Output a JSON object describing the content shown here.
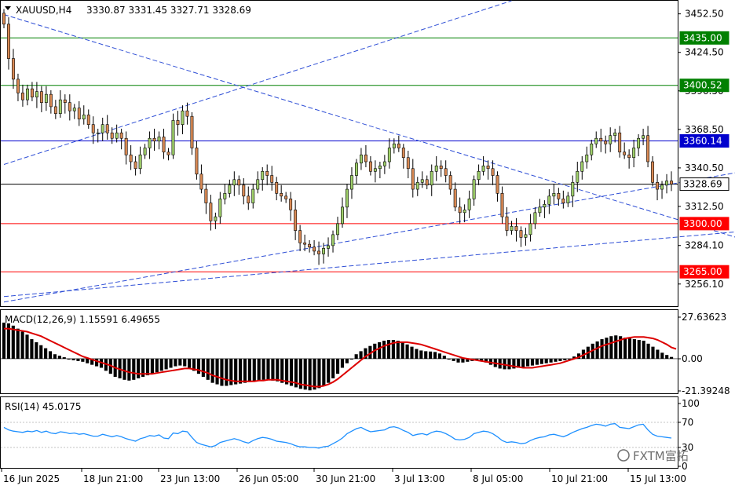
{
  "header": {
    "symbol": "XAUUSD,H4",
    "ohlc": "3330.87 3331.45 3327.71 3328.69"
  },
  "watermark": "FXTM富拓",
  "colors": {
    "bull": "#9fcf6a",
    "bear": "#d98a55",
    "wick": "#000000",
    "green_level": "#008000",
    "blue_level": "#0000cd",
    "red_level": "#ff0000",
    "current_level": "#000000",
    "trend_line": "#2f4fd6",
    "macd_hist": "#000000",
    "macd_signal": "#dd0000",
    "rsi_line": "#1e90ff"
  },
  "chart_data": [
    {
      "type": "candlestick",
      "title": "XAUUSD,H4",
      "ylim": [
        3240,
        3462
      ],
      "y_ticks": [
        "3452.50",
        "3424.50",
        "3396.50",
        "3368.50",
        "3340.50",
        "3312.50",
        "3284.10",
        "3256.10"
      ],
      "x_ticks": [
        "16 Jun 2025",
        "18 Jun 21:00",
        "23 Jun 13:00",
        "26 Jun 05:00",
        "30 Jun 21:00",
        "3 Jul 13:00",
        "8 Jul 05:00",
        "10 Jul 21:00",
        "15 Jul 13:00"
      ],
      "levels": [
        {
          "name": "resistance",
          "value": 3435.0,
          "label": "3435.00",
          "color": "#008000"
        },
        {
          "name": "resistance",
          "value": 3400.52,
          "label": "3400.52",
          "color": "#008000"
        },
        {
          "name": "pivot",
          "value": 3360.14,
          "label": "3360.14",
          "color": "#0000cd"
        },
        {
          "name": "current",
          "value": 3328.69,
          "label": "3328.69",
          "color": "#000000"
        },
        {
          "name": "support",
          "value": 3300.0,
          "label": "3300.00",
          "color": "#ff0000"
        },
        {
          "name": "support",
          "value": 3265.0,
          "label": "3265.00",
          "color": "#ff0000"
        }
      ],
      "trend_lines": [
        {
          "from": [
            0,
            3343
          ],
          "to": [
            108,
            3462
          ]
        },
        {
          "from": [
            0,
            3452
          ],
          "to": [
            200,
            3244
          ]
        },
        {
          "from": [
            0,
            3243
          ],
          "to": [
            212,
            3371
          ]
        },
        {
          "from": [
            0,
            3247
          ],
          "to": [
            212,
            3311
          ]
        }
      ],
      "closes": [
        3445,
        3420,
        3405,
        3395,
        3390,
        3398,
        3392,
        3396,
        3388,
        3394,
        3385,
        3380,
        3390,
        3388,
        3382,
        3384,
        3376,
        3379,
        3372,
        3366,
        3366,
        3372,
        3366,
        3362,
        3366,
        3362,
        3350,
        3345,
        3340,
        3350,
        3355,
        3362,
        3360,
        3363,
        3352,
        3350,
        3375,
        3372,
        3382,
        3378,
        3355,
        3336,
        3325,
        3315,
        3302,
        3305,
        3318,
        3322,
        3328,
        3332,
        3328,
        3320,
        3315,
        3325,
        3332,
        3338,
        3335,
        3330,
        3322,
        3320,
        3318,
        3310,
        3295,
        3286,
        3285,
        3283,
        3280,
        3278,
        3282,
        3284,
        3292,
        3300,
        3312,
        3325,
        3335,
        3344,
        3350,
        3345,
        3338,
        3340,
        3342,
        3345,
        3355,
        3358,
        3355,
        3348,
        3340,
        3325,
        3330,
        3332,
        3328,
        3338,
        3342,
        3340,
        3335,
        3325,
        3312,
        3308,
        3310,
        3318,
        3332,
        3338,
        3342,
        3340,
        3335,
        3322,
        3305,
        3295,
        3298,
        3295,
        3290,
        3292,
        3300,
        3308,
        3312,
        3314,
        3320,
        3322,
        3318,
        3315,
        3320,
        3330,
        3338,
        3345,
        3350,
        3358,
        3362,
        3360,
        3358,
        3364,
        3366,
        3352,
        3350,
        3348,
        3355,
        3362,
        3364,
        3345,
        3330,
        3325,
        3328,
        3331,
        3328.69
      ]
    },
    {
      "type": "bar",
      "title": "MACD(12,26,9) 1.15591 6.49655",
      "ylim": [
        -21.39248,
        27.63623
      ],
      "y_ticks": [
        "27.63623",
        "0.00",
        "-21.39248"
      ],
      "series": [
        {
          "name": "main",
          "values": [
            24,
            23.5,
            22,
            20,
            18,
            16,
            13,
            11,
            9,
            7,
            5,
            3,
            2,
            1,
            -0.5,
            -1,
            -1.5,
            -2,
            -3,
            -4,
            -5,
            -6,
            -8,
            -10,
            -12,
            -13,
            -14,
            -14.5,
            -14,
            -13,
            -12,
            -11,
            -10,
            -9,
            -8,
            -7,
            -6,
            -5,
            -4.5,
            -5,
            -6,
            -8,
            -10,
            -12,
            -14,
            -16,
            -17,
            -18,
            -18,
            -17.5,
            -17,
            -16.5,
            -16,
            -15.5,
            -15,
            -14.5,
            -14,
            -14,
            -14.5,
            -15,
            -16,
            -17,
            -18,
            -19,
            -20,
            -20.5,
            -21,
            -20.5,
            -19.5,
            -18,
            -16,
            -13,
            -10,
            -6,
            -3,
            0,
            3,
            5,
            7,
            8.5,
            10,
            11,
            12,
            12.5,
            12.5,
            12,
            11,
            9.5,
            8,
            6.5,
            5.5,
            5,
            4.8,
            4.5,
            3.5,
            2,
            0,
            -1.5,
            -2.5,
            -2.5,
            -2,
            -1.5,
            -1,
            -1.5,
            -2.5,
            -4,
            -5.5,
            -6.5,
            -7,
            -7,
            -6.5,
            -6,
            -5.5,
            -5,
            -4.5,
            -4,
            -3.5,
            -3,
            -2.5,
            -2,
            -1.5,
            -1,
            0,
            1.5,
            3.5,
            6,
            8,
            10,
            11.5,
            13,
            14,
            15,
            15.5,
            15,
            14,
            13.5,
            13,
            12.5,
            12,
            10,
            8,
            6,
            4,
            2.5,
            1.2
          ],
          "plotted_as": "histogram"
        },
        {
          "name": "signal",
          "values": [
            20,
            20,
            19.5,
            19,
            18.5,
            18,
            17,
            16,
            15,
            13.5,
            12,
            10.5,
            9,
            7.5,
            6,
            4.5,
            3,
            1.5,
            0.5,
            -0.5,
            -1.5,
            -2.5,
            -3.5,
            -4.5,
            -6,
            -7,
            -8,
            -9,
            -9.5,
            -10,
            -10,
            -10,
            -10,
            -9.5,
            -9,
            -8.5,
            -8,
            -7.5,
            -7,
            -6.5,
            -6.5,
            -7,
            -7.5,
            -8.5,
            -9.5,
            -11,
            -12,
            -13,
            -14,
            -14.5,
            -15,
            -15,
            -15,
            -15,
            -15,
            -14.5,
            -14.5,
            -14,
            -14,
            -14,
            -14.5,
            -15,
            -15.5,
            -16,
            -17,
            -17.5,
            -18,
            -18.5,
            -18.5,
            -18,
            -17,
            -15.5,
            -13.5,
            -11,
            -8.5,
            -6,
            -3.5,
            -1,
            1.5,
            3.5,
            5.5,
            7,
            8.5,
            9.5,
            10.5,
            11,
            11,
            11,
            10.5,
            10,
            9.5,
            8.5,
            7.5,
            6.5,
            5.5,
            4.5,
            3.5,
            2.5,
            1.5,
            0.5,
            0,
            -0.5,
            -1,
            -1.5,
            -2,
            -2.5,
            -3,
            -3.5,
            -4,
            -4.5,
            -5,
            -5.5,
            -6,
            -6,
            -6,
            -5.5,
            -5,
            -4.5,
            -4,
            -3.5,
            -3,
            -2,
            -1,
            0,
            1,
            2.5,
            4,
            5.5,
            7,
            8.5,
            9.5,
            10.5,
            11.5,
            12.5,
            13.5,
            14,
            14.5,
            14.5,
            14.5,
            14,
            13.5,
            12.5,
            11,
            9.5,
            7.5,
            6.5
          ],
          "plotted_as": "line"
        }
      ]
    },
    {
      "type": "line",
      "title": "RSI(14) 45.0175",
      "ylim": [
        0,
        100
      ],
      "y_ticks": [
        "100",
        "70",
        "30",
        "0"
      ],
      "levels": [
        70,
        30
      ],
      "series": [
        {
          "name": "RSI",
          "values": [
            62,
            58,
            56,
            55,
            54,
            56,
            55,
            57,
            54,
            56,
            53,
            52,
            55,
            54,
            52,
            53,
            51,
            52,
            50,
            48,
            48,
            51,
            49,
            47,
            49,
            47,
            44,
            42,
            40,
            44,
            46,
            49,
            48,
            50,
            45,
            44,
            53,
            52,
            56,
            55,
            46,
            38,
            35,
            33,
            31,
            33,
            38,
            40,
            42,
            44,
            42,
            39,
            37,
            41,
            44,
            46,
            45,
            43,
            40,
            39,
            38,
            36,
            33,
            31,
            31,
            30,
            30,
            29,
            31,
            32,
            36,
            40,
            45,
            52,
            56,
            60,
            62,
            58,
            55,
            56,
            57,
            58,
            62,
            63,
            61,
            57,
            54,
            49,
            51,
            52,
            50,
            54,
            56,
            55,
            52,
            48,
            43,
            42,
            43,
            46,
            52,
            54,
            56,
            55,
            52,
            47,
            41,
            38,
            39,
            38,
            36,
            37,
            41,
            44,
            46,
            47,
            50,
            51,
            49,
            47,
            50,
            54,
            57,
            60,
            62,
            65,
            67,
            66,
            64,
            67,
            68,
            62,
            61,
            60,
            63,
            66,
            67,
            58,
            51,
            48,
            47,
            46,
            45.0175
          ]
        }
      ]
    }
  ]
}
